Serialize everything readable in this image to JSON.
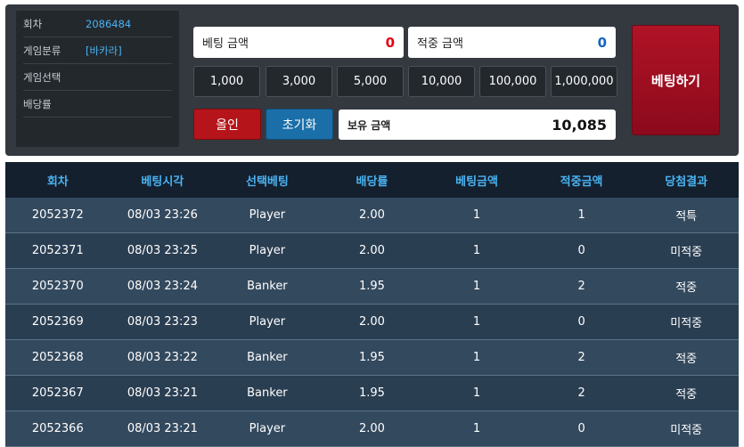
{
  "info": {
    "round_label": "회차",
    "round_value": "2086484",
    "category_label": "게임분류",
    "category_value": "[바카라]",
    "select_label": "게임선택",
    "select_value": "",
    "odds_label": "배당률",
    "odds_value": ""
  },
  "bet": {
    "bet_amount_label": "베팅 금액",
    "bet_amount_value": "0",
    "win_amount_label": "적중 금액",
    "win_amount_value": "0",
    "chips": [
      "1,000",
      "3,000",
      "5,000",
      "10,000",
      "100,000",
      "1,000,000"
    ],
    "allin_label": "올인",
    "reset_label": "초기화",
    "hold_label": "보유 금액",
    "hold_value": "10,085",
    "submit_label": "베팅하기"
  },
  "history": {
    "headers": [
      "회차",
      "베팅시각",
      "선택베팅",
      "배당률",
      "베팅금액",
      "적중금액",
      "당첨결과"
    ],
    "rows": [
      {
        "round": "2052372",
        "time": "08/03 23:26",
        "pick": "Player",
        "odds": "2.00",
        "bet": "1",
        "win": "1",
        "result": "적특",
        "status": "win"
      },
      {
        "round": "2052371",
        "time": "08/03 23:25",
        "pick": "Player",
        "odds": "2.00",
        "bet": "1",
        "win": "0",
        "result": "미적중",
        "status": "lose"
      },
      {
        "round": "2052370",
        "time": "08/03 23:24",
        "pick": "Banker",
        "odds": "1.95",
        "bet": "1",
        "win": "2",
        "result": "적중",
        "status": "win"
      },
      {
        "round": "2052369",
        "time": "08/03 23:23",
        "pick": "Player",
        "odds": "2.00",
        "bet": "1",
        "win": "0",
        "result": "미적중",
        "status": "lose"
      },
      {
        "round": "2052368",
        "time": "08/03 23:22",
        "pick": "Banker",
        "odds": "1.95",
        "bet": "1",
        "win": "2",
        "result": "적중",
        "status": "win"
      },
      {
        "round": "2052367",
        "time": "08/03 23:21",
        "pick": "Banker",
        "odds": "1.95",
        "bet": "1",
        "win": "2",
        "result": "적중",
        "status": "win"
      },
      {
        "round": "2052366",
        "time": "08/03 23:21",
        "pick": "Player",
        "odds": "2.00",
        "bet": "1",
        "win": "0",
        "result": "미적중",
        "status": "lose"
      }
    ]
  },
  "colors": {
    "win": "#f5a623",
    "lose": "#e0172a",
    "accent": "#4ab3f2"
  }
}
